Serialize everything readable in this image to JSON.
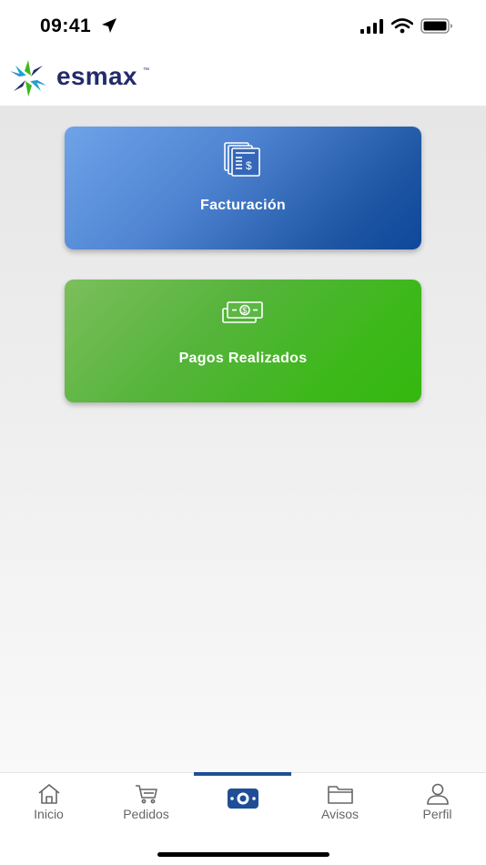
{
  "status_bar": {
    "time": "09:41"
  },
  "header": {
    "logo_text": "esmax",
    "logo_mark": "™"
  },
  "cards": [
    {
      "label": "Facturación",
      "icon": "invoice-icon",
      "color": "#2d63b3"
    },
    {
      "label": "Pagos Realizados",
      "icon": "cash-icon",
      "color": "#41b822"
    }
  ],
  "tabs": [
    {
      "label": "Inicio",
      "icon": "home-icon"
    },
    {
      "label": "Pedidos",
      "icon": "cart-icon"
    },
    {
      "label": "",
      "icon": "payments-icon",
      "active": true
    },
    {
      "label": "Avisos",
      "icon": "folder-icon"
    },
    {
      "label": "Perfil",
      "icon": "user-icon"
    }
  ],
  "colors": {
    "brand_navy": "#232b6b",
    "active_tab": "#1f4e97",
    "tab_label": "#666666"
  }
}
